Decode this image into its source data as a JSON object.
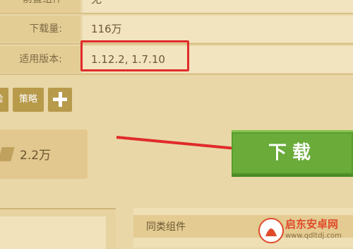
{
  "info": {
    "rows": [
      {
        "label": "前置组件",
        "value": "无"
      },
      {
        "label": "下载量:",
        "value": "116万"
      },
      {
        "label": "适用版本:",
        "value": "1.12.2, 1.7.10"
      }
    ]
  },
  "tags": {
    "tag1": "险",
    "tag2": "策略"
  },
  "rating": {
    "value": "2.2万"
  },
  "download": {
    "label": "下载"
  },
  "related": {
    "header": "同类组件"
  },
  "watermark": {
    "text": "启东安卓网",
    "url": "www.qdltdj.com"
  },
  "colors": {
    "accent": "#6aab3a",
    "highlight": "#e02b2b",
    "tag": "#b79a4a"
  },
  "icons": {
    "add": "plus-icon",
    "rating": "thumb-icon",
    "arrow": "red-arrow"
  }
}
